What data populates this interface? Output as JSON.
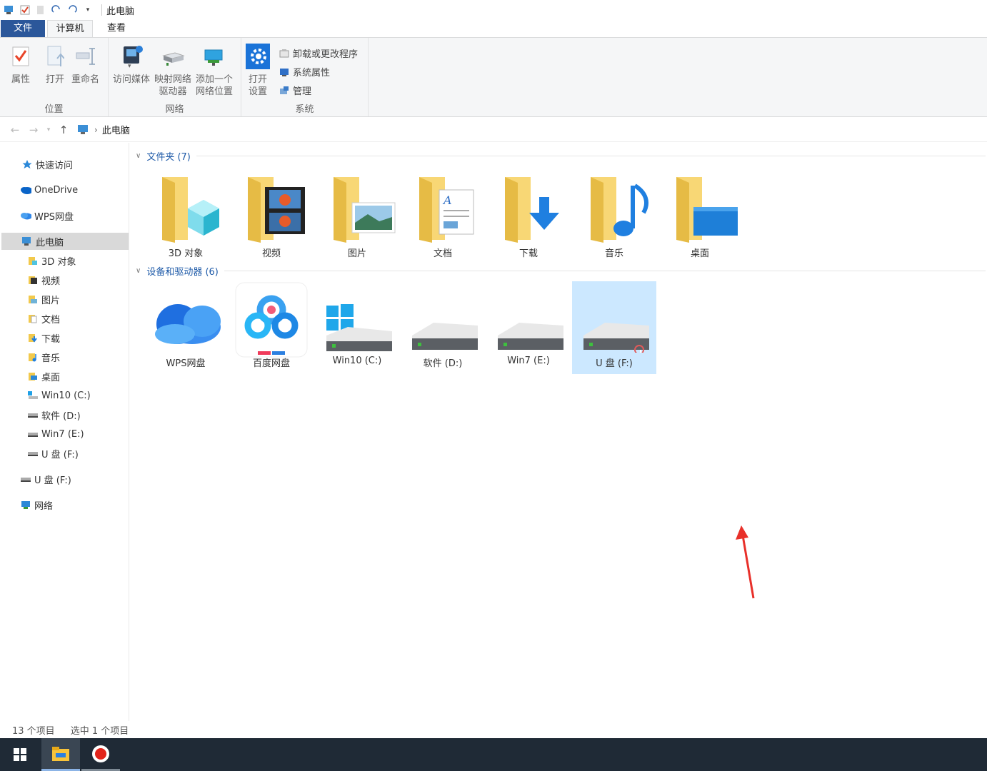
{
  "window": {
    "title": "此电脑"
  },
  "ribbon": {
    "tabs": {
      "file": "文件",
      "computer": "计算机",
      "view": "查看"
    },
    "location": {
      "label": "位置",
      "properties": "属性",
      "open": "打开",
      "rename": "重命名"
    },
    "network": {
      "label": "网络",
      "access_media": "访问媒体",
      "map_drive_line1": "映射网络",
      "map_drive_line2": "驱动器",
      "add_location_line1": "添加一个",
      "add_location_line2": "网络位置"
    },
    "system": {
      "label": "系统",
      "open_settings_line1": "打开",
      "open_settings_line2": "设置",
      "uninstall": "卸载或更改程序",
      "system_properties": "系统属性",
      "manage": "管理"
    }
  },
  "address": {
    "breadcrumb": "此电脑"
  },
  "sidebar": {
    "quick_access": "快速访问",
    "onedrive": "OneDrive",
    "wps_cloud": "WPS网盘",
    "this_pc": "此电脑",
    "items": [
      "3D 对象",
      "视频",
      "图片",
      "文档",
      "下载",
      "音乐",
      "桌面",
      "Win10 (C:)",
      "软件 (D:)",
      "Win7 (E:)",
      "U 盘 (F:)"
    ],
    "usb": "U 盘 (F:)",
    "network": "网络"
  },
  "content": {
    "folders_header": "文件夹 (7)",
    "folders": [
      "3D 对象",
      "视频",
      "图片",
      "文档",
      "下载",
      "音乐",
      "桌面"
    ],
    "devices_header": "设备和驱动器 (6)",
    "devices": [
      "WPS网盘",
      "百度网盘",
      "Win10 (C:)",
      "软件 (D:)",
      "Win7 (E:)",
      "U 盘 (F:)"
    ],
    "selected_device": "U 盘 (F:)"
  },
  "status": {
    "item_count": "13 个项目",
    "selected": "选中 1 个项目"
  },
  "colors": {
    "accent": "#2b579a",
    "selection": "#cce8ff",
    "folder": "#f8d775",
    "taskbar": "#1f2a36",
    "annotation_arrow": "#e8302a"
  }
}
